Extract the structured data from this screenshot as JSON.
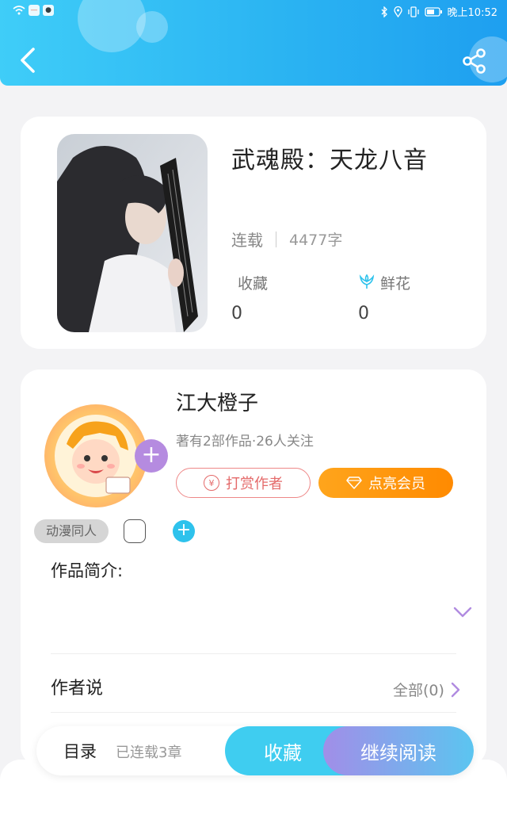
{
  "status_bar": {
    "time": "晚上10:52"
  },
  "book": {
    "title": "武魂殿：天龙八音",
    "status": "连载",
    "word_count": "4477字",
    "stats": [
      {
        "label": "收藏",
        "value": "0"
      },
      {
        "label": "鲜花",
        "value": "0"
      }
    ]
  },
  "author": {
    "name": "江大橙子",
    "summary": "著有2部作品·26人关注",
    "tip_label": "打赏作者",
    "vip_label": "点亮会员",
    "tag": "动漫同人"
  },
  "intro": {
    "label": "作品简介:"
  },
  "author_says": {
    "label": "作者说",
    "link": "全部(0)"
  },
  "bottom": {
    "toc": "目录",
    "chapters": "已连载3章",
    "favorite": "收藏",
    "continue": "继续阅读"
  },
  "colors": {
    "header": "#2bb4f2",
    "accent_cyan": "#3fcdf0",
    "vip_orange": "#ff8a00",
    "tip_red": "#e46a6a",
    "purple": "#b58be0"
  },
  "icons": [
    "back-icon",
    "share-icon",
    "flower-icon",
    "yen-icon",
    "diamond-icon",
    "plus-icon",
    "chevron-down-icon",
    "chevron-right-icon",
    "wifi-icon",
    "bluetooth-icon",
    "battery-icon"
  ]
}
